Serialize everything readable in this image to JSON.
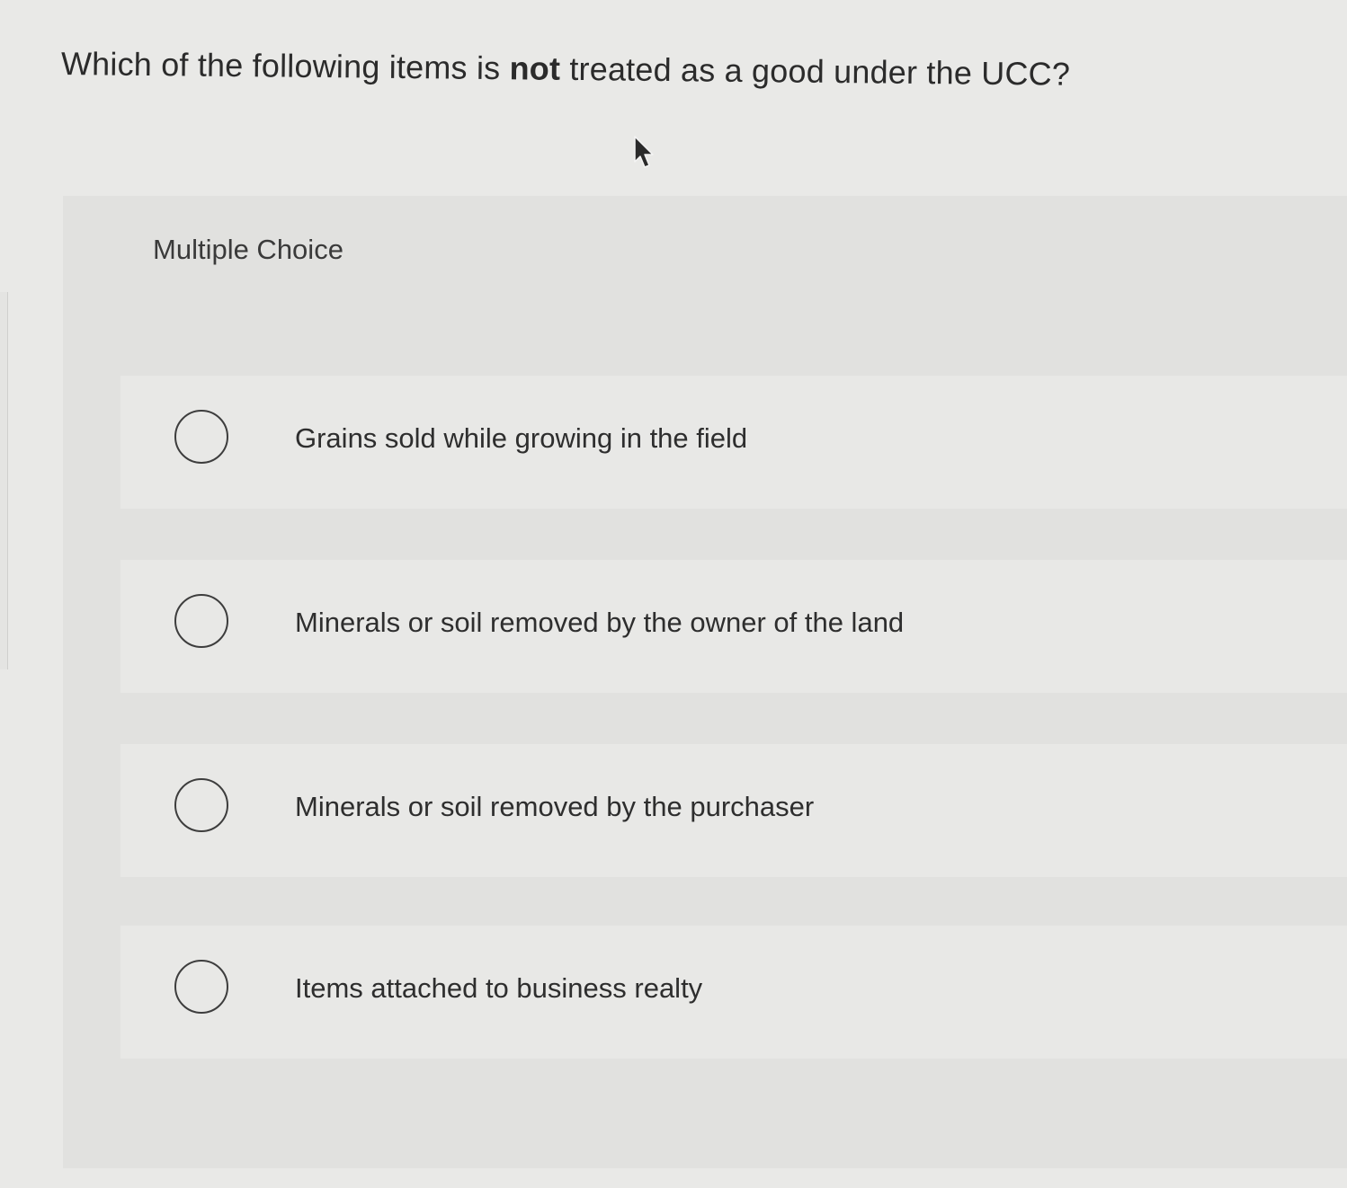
{
  "question": {
    "before": "Which of the following items is ",
    "emphasis": "not",
    "after": " treated as a good under the UCC?"
  },
  "section_label": "Multiple Choice",
  "choices": [
    {
      "label": "Grains sold while growing in the field",
      "selected": false
    },
    {
      "label": "Minerals or soil removed by the owner of the land",
      "selected": false
    },
    {
      "label": "Minerals or soil removed by the purchaser",
      "selected": false
    },
    {
      "label": "Items attached to business realty",
      "selected": false
    }
  ],
  "icons": {
    "cursor": "mouse-pointer-icon",
    "radio": "radio-unselected-icon"
  },
  "colors": {
    "background": "#e9e9e7",
    "panel": "#e1e1df",
    "choice_row": "#e8e8e6",
    "text": "#2b2b2b"
  }
}
